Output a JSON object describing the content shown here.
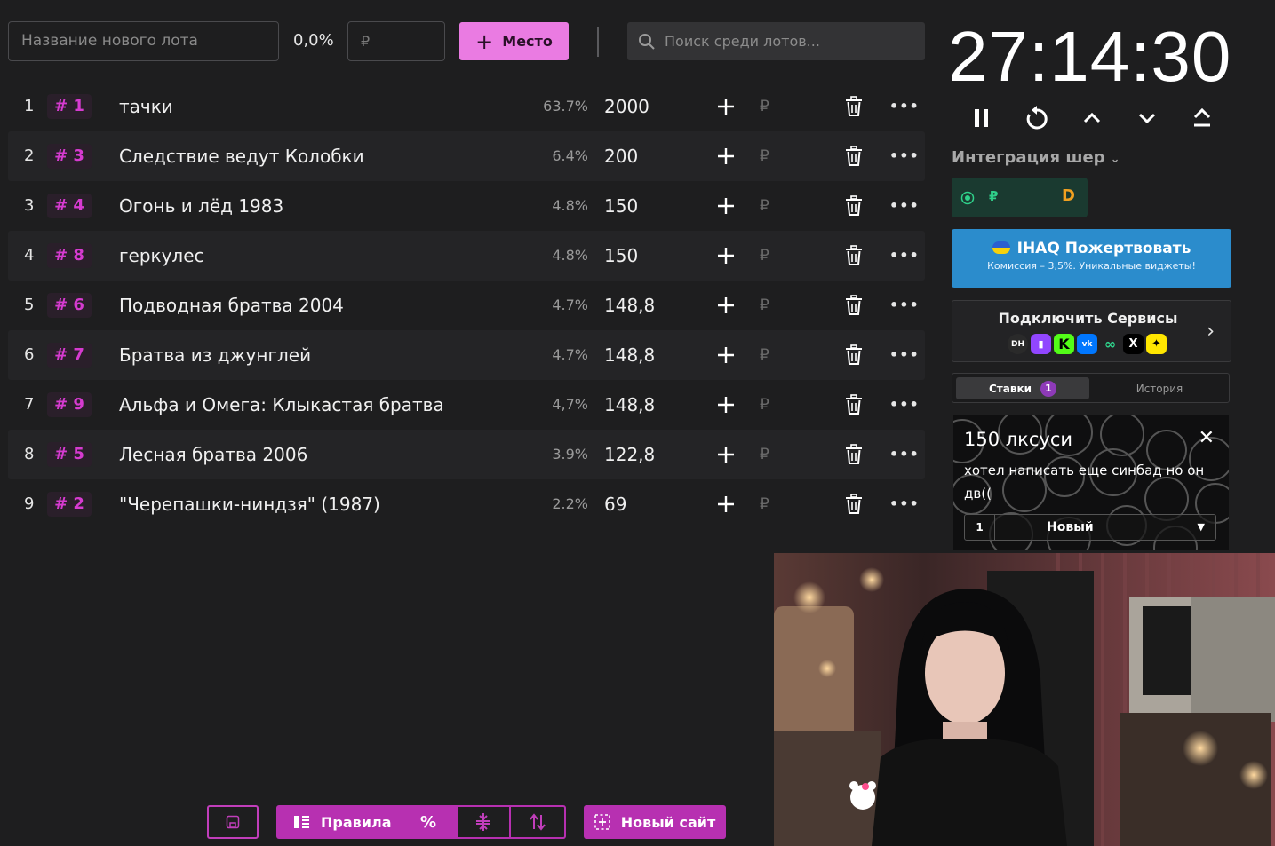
{
  "top": {
    "lot_name_placeholder": "Название нового лота",
    "new_percent": "0,0%",
    "currency_placeholder": "₽",
    "add_button_label": "Место",
    "search_placeholder": "Поиск среди лотов..."
  },
  "lots": [
    {
      "index": "1",
      "id": "# 1",
      "name": "тачки",
      "percent": "63.7%",
      "amount": "2000",
      "currency": "₽"
    },
    {
      "index": "2",
      "id": "# 3",
      "name": "Следствие ведут Колобки",
      "percent": "6.4%",
      "amount": "200",
      "currency": "₽"
    },
    {
      "index": "3",
      "id": "# 4",
      "name": "Огонь и лёд 1983",
      "percent": "4.8%",
      "amount": "150",
      "currency": "₽"
    },
    {
      "index": "4",
      "id": "# 8",
      "name": "геркулес",
      "percent": "4.8%",
      "amount": "150",
      "currency": "₽"
    },
    {
      "index": "5",
      "id": "# 6",
      "name": "Подводная братва 2004",
      "percent": "4.7%",
      "amount": "148,8",
      "currency": "₽"
    },
    {
      "index": "6",
      "id": "# 7",
      "name": "Братва из джунглей",
      "percent": "4.7%",
      "amount": "148,8",
      "currency": "₽"
    },
    {
      "index": "7",
      "id": "# 9",
      "name": "Альфа и Омега: Клыкастая братва",
      "percent": "4,7%",
      "amount": "148,8",
      "currency": "₽"
    },
    {
      "index": "8",
      "id": "# 5",
      "name": "Лесная братва 2006",
      "percent": "3.9%",
      "amount": "122,8",
      "currency": "₽"
    },
    {
      "index": "9",
      "id": "# 2",
      "name": "\"Черепашки-ниндзя\" (1987)",
      "percent": "2.2%",
      "amount": "69",
      "currency": "₽"
    }
  ],
  "timer": {
    "time": "27:14:30"
  },
  "sidebar": {
    "integration_label": "Интеграция шер",
    "pay_currency": "₽",
    "pay_logo": "D",
    "donate_title": "IHAQ Пожертвовать",
    "donate_subtitle": "Комиссия – 3,5%. Уникальные виджеты!",
    "services_title": "Подключить Сервисы",
    "service_icons": [
      "DH",
      "twitch-icon",
      "K",
      "vk-icon",
      "infinity-icon",
      "x-icon",
      "star-icon"
    ],
    "tab_bids": "Ставки",
    "tab_bids_count": "1",
    "tab_history": "История",
    "bid_title": "150 лксуси",
    "bid_message": "хотел написать еще синбад но он дв((",
    "bid_number": "1",
    "bid_select": "Новый"
  },
  "bottom": {
    "rules_label": "Правила",
    "percent_symbol": "%",
    "new_site_label": "Новый сайт"
  },
  "colors": {
    "accent": "#ea7be2",
    "accent_dark": "#b730b1",
    "lot_id": "#d63bd0",
    "background": "#1e1e1f",
    "donate": "#2b8ccc"
  }
}
